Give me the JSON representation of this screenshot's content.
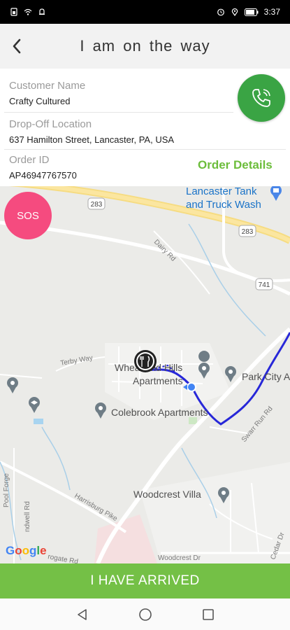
{
  "status_bar": {
    "time": "3:37",
    "left_icons": [
      "sim-icon",
      "wifi-icon",
      "notification-bell-icon"
    ],
    "right_icons": [
      "alarm-icon",
      "location-icon",
      "battery-icon"
    ]
  },
  "header": {
    "title": "I am on  the  way",
    "back_icon": "chevron-left-icon"
  },
  "order": {
    "customer_name_label": "Customer Name",
    "customer_name": "Crafty Cultured",
    "dropoff_label": "Drop-Off Location",
    "dropoff_value": "637 Hamilton Street, Lancaster, PA, USA",
    "order_id_label": "Order ID",
    "order_id": "AP46947767570",
    "order_details_link": "Order Details"
  },
  "call_button": {
    "icon": "phone-icon",
    "color": "#3aa444"
  },
  "sos": {
    "label": "SOS",
    "color": "#f54b7f"
  },
  "map": {
    "places": {
      "lancaster_tank": "Lancaster Tank\nand Truck Wash",
      "lancaster_tank_line1": "Lancaster Tank",
      "lancaster_tank_line2": "and Truck Wash",
      "wheatland_line1": "Wheatland Hills",
      "wheatland_line2": "Apartments",
      "park_city": "Park City A",
      "colebrook": "Colebrook Apartments",
      "woodcrest": "Woodcrest Villa"
    },
    "roads": {
      "dairy_rd": "Dairy Rd",
      "terby_way": "Terby Way",
      "swarr_run": "Swarr Run Rd",
      "harrisburg_pike": "Harrisburg Pike",
      "pool_forge": "Pool Forge",
      "woodcrest_dr": "Woodcrest Dr",
      "gate_rd": "rogate Rd",
      "ndwell_rd": "ndwell Rd",
      "cedar": "Cedar Dr"
    },
    "shields": [
      "283",
      "283",
      "741"
    ],
    "attribution": "Google",
    "route_color": "#2727d8"
  },
  "footer": {
    "arrived_label": "I HAVE ARRIVED",
    "color": "#74c046"
  },
  "nav_bar": {
    "buttons": [
      "back-triangle-icon",
      "home-circle-icon",
      "recents-square-icon"
    ]
  }
}
